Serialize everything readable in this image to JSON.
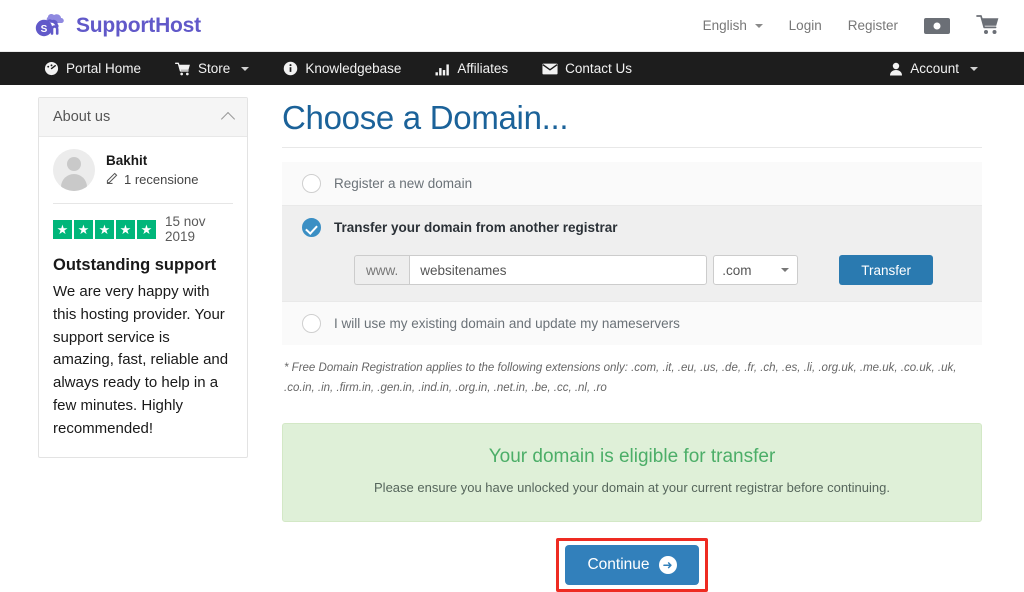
{
  "header": {
    "brand": "SupportHost",
    "logo_icon": "cloud-host-logo-icon",
    "language": "English",
    "login": "Login",
    "register": "Register",
    "currency_icon": "banknote-icon",
    "cart_icon": "shopping-cart-icon"
  },
  "nav": {
    "items": [
      {
        "label": "Portal Home",
        "icon": "dashboard-icon"
      },
      {
        "label": "Store",
        "icon": "cart-icon",
        "caret": true
      },
      {
        "label": "Knowledgebase",
        "icon": "info-circle-icon"
      },
      {
        "label": "Affiliates",
        "icon": "bar-chart-icon"
      },
      {
        "label": "Contact Us",
        "icon": "envelope-icon"
      }
    ],
    "account": {
      "label": "Account",
      "icon": "user-icon",
      "caret": true
    }
  },
  "sidebar": {
    "panel_title": "About us",
    "collapse_icon": "chevron-up-icon",
    "review": {
      "avatar_icon": "user-avatar-icon",
      "name": "Bakhit",
      "reviews_count_label": "1 recensione",
      "edit_icon": "pencil-icon",
      "stars": 5,
      "star_color": "#00b67a",
      "date": "15 nov 2019",
      "title": "Outstanding support",
      "body": "We are very happy with this hosting provider. Your support service is amazing, fast, reliable and always ready to help in a few minutes. Highly recommended!"
    }
  },
  "main": {
    "page_title": "Choose a Domain...",
    "options": [
      {
        "label": "Register a new domain",
        "selected": false
      },
      {
        "label": "Transfer your domain from another registrar",
        "selected": true
      },
      {
        "label": "I will use my existing domain and update my nameservers",
        "selected": false
      }
    ],
    "domain_form": {
      "prefix": "www.",
      "value": "websitenames",
      "placeholder": "",
      "tld_selected": ".com",
      "tld_caret_icon": "chevron-down-icon",
      "submit_label": "Transfer"
    },
    "note": "* Free Domain Registration applies to the following extensions only: .com, .it, .eu, .us, .de, .fr, .ch, .es, .li, .org.uk, .me.uk, .co.uk, .uk, .co.in, .in, .firm.in, .gen.in, .ind.in, .org.in, .net.in, .be, .cc, .nl, .ro",
    "alert": {
      "title": "Your domain is eligible for transfer",
      "subtitle": "Please ensure you have unlocked your domain at your current registrar before continuing.",
      "bg_color": "#dff0d8",
      "title_color": "#4cae68"
    },
    "continue": {
      "label": "Continue",
      "arrow_icon": "arrow-right-circle-icon",
      "button_color": "#3280bb",
      "highlight_color": "#ee2b22"
    }
  }
}
